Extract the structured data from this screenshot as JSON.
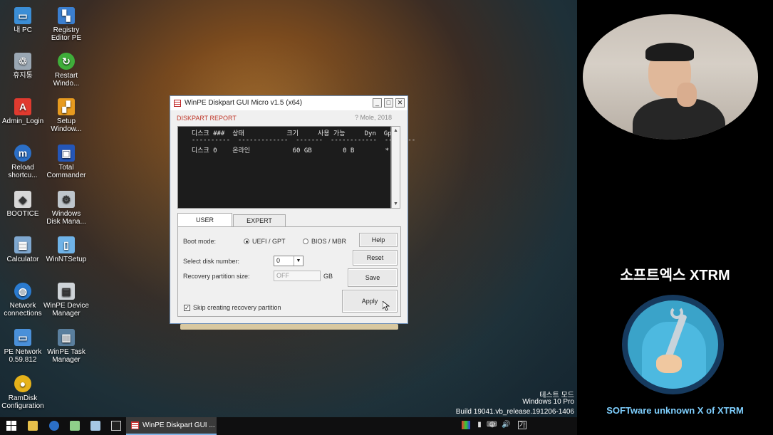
{
  "desktop": {
    "icons": [
      {
        "label": "내 PC"
      },
      {
        "label": "Registry\nEditor PE"
      },
      {
        "label": "휴지통"
      },
      {
        "label": "Restart\nWindo..."
      },
      {
        "label": "Admin_Login"
      },
      {
        "label": "Setup\nWindow..."
      },
      {
        "label": "Reload\nshortcu..."
      },
      {
        "label": "Total\nCommander"
      },
      {
        "label": "BOOTICE"
      },
      {
        "label": "Windows\nDisk Mana..."
      },
      {
        "label": "Calculator"
      },
      {
        "label": "WinNTSetup"
      },
      {
        "label": "Network\nconnections"
      },
      {
        "label": "WinPE Device\nManager"
      },
      {
        "label": "PE Network\n0.59.812"
      },
      {
        "label": "WinPE Task\nManager"
      },
      {
        "label": "RamDisk\nConfiguration"
      }
    ],
    "watermark": {
      "line1": "테스트 모드",
      "line2": "Windows 10 Pro",
      "line3": "Build 19041.vb_release.191206-1406"
    }
  },
  "window": {
    "title": "WinPE Diskpart GUI Micro v1.5 (x64)",
    "report_label": "DISKPART REPORT",
    "credit": "? Mole, 2018",
    "console_lines": [
      "  디스크 ###  상태           크기     사용 가능     Dyn  Gpt",
      "  ----------  -------------  -------  ------------  ---  ---",
      "  디스크 0    온라인           60 GB        0 B        *"
    ],
    "tabs": {
      "user": "USER",
      "expert": "EXPERT"
    },
    "boot_mode_label": "Boot mode:",
    "uefi_label": "UEFI / GPT",
    "bios_label": "BIOS / MBR",
    "select_disk_label": "Select disk number:",
    "disk_value": "0",
    "recovery_label": "Recovery partition size:",
    "recovery_value": "OFF",
    "recovery_unit": "GB",
    "skip_recovery_label": "Skip creating recovery partition",
    "buttons": {
      "help": "Help",
      "reset": "Reset",
      "save": "Save",
      "apply": "Apply"
    }
  },
  "taskbar": {
    "active_task": "WinPE Diskpart GUI ..."
  },
  "brand": {
    "title": "소프트엑스 XTRM",
    "subtitle": "SOFTware unknown X of XTRM"
  }
}
